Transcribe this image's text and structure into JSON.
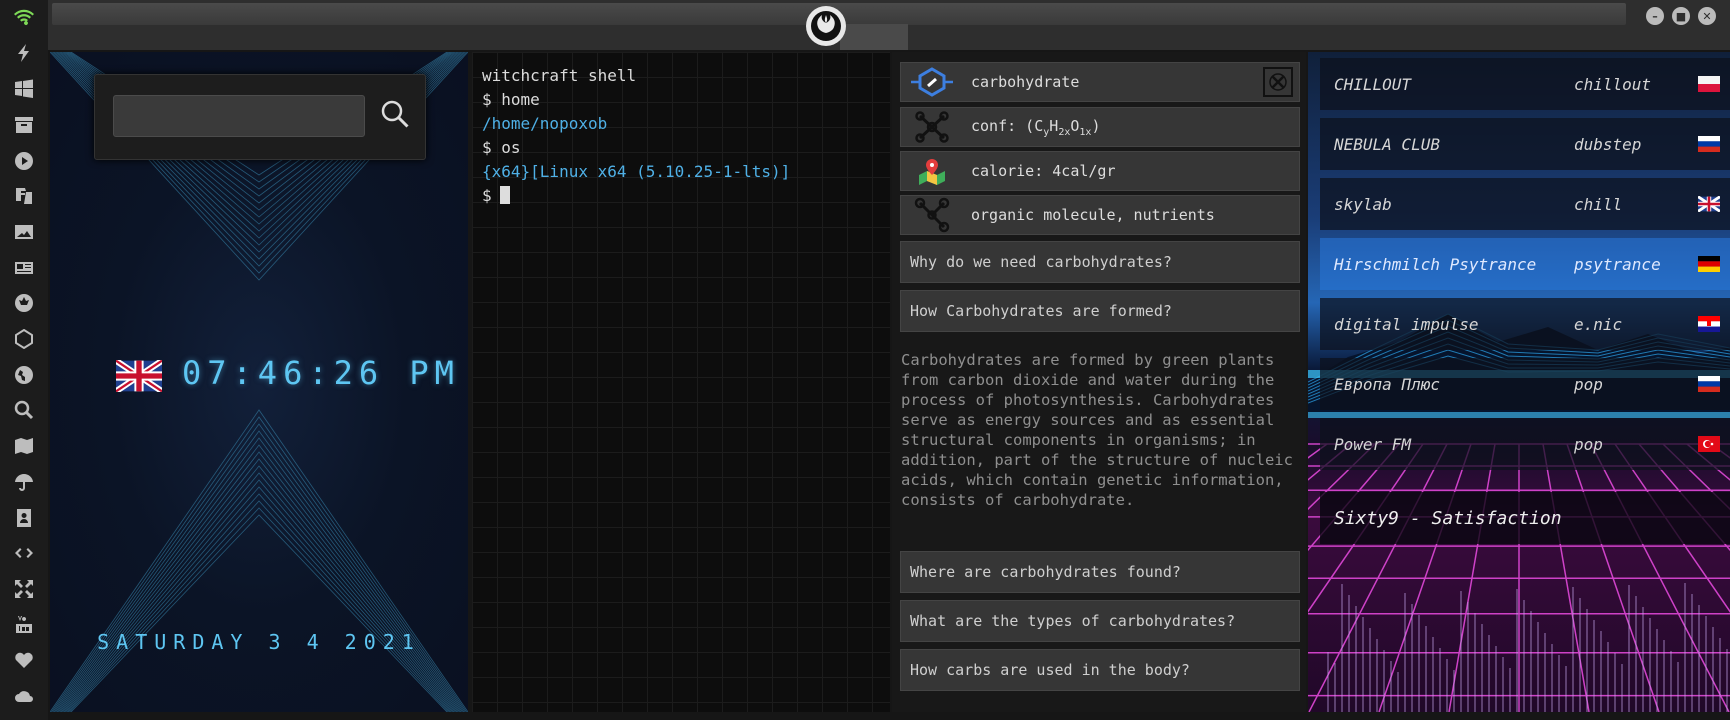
{
  "sidebar": {
    "icons": [
      "wifi-icon",
      "lightning-icon",
      "windows-icon",
      "archive-icon",
      "play-icon",
      "translate-icon",
      "image-icon",
      "newspaper-icon",
      "rebel-icon",
      "sketch-icon",
      "globe-icon",
      "search-icon",
      "map-icon",
      "umbrella-icon",
      "contact-icon",
      "code-icon",
      "expand-icon",
      "youtube-icon",
      "heart-icon",
      "cloud-icon"
    ]
  },
  "clock": {
    "search_placeholder": "",
    "time": "07:46:26 PM",
    "date": "SATURDAY 3 4 2021"
  },
  "terminal": {
    "lines": [
      "witchcraft shell",
      "$ home",
      "/home/nopoxob",
      "$ os",
      "{x64}[Linux x64 (5.10.25-1-lts)]",
      "$"
    ]
  },
  "info": {
    "title": "carbohydrate",
    "formula_prefix": "conf: (C",
    "formula_sub1": "y",
    "formula_h": "H",
    "formula_sub2": "2x",
    "formula_o": "O",
    "formula_sub3": "1x",
    "formula_suffix": ")",
    "calorie": "calorie: 4cal/gr",
    "category": "organic molecule, nutrients",
    "faq": [
      "Why do we need carbohydrates?",
      "How Carbohydrates are formed?",
      "Where are carbohydrates found?",
      "What are the types of carbohydrates?",
      "How carbs are used in the body?"
    ],
    "answer": "Carbohydrates are formed by green plants from carbon dioxide and water during the process of photosynthesis. Carbohydrates serve as energy sources and as essential structural components in organisms; in addition, part of the structure of nucleic acids, which contain genetic information, consists of carbohydrate."
  },
  "radio": {
    "stations": [
      {
        "name": "CHILLOUT",
        "genre": "chillout",
        "flag": "flag-pl"
      },
      {
        "name": "NEBULA CLUB",
        "genre": "dubstep",
        "flag": "flag-ru"
      },
      {
        "name": "skylab",
        "genre": "chill",
        "flag": "flag-uk"
      },
      {
        "name": "Hirschmilch Psytrance",
        "genre": "psytrance",
        "flag": "flag-de"
      },
      {
        "name": "digital impulse",
        "genre": "e.nic",
        "flag": "flag-hr"
      },
      {
        "name": "Европа Плюс",
        "genre": "pop",
        "flag": "flag-ru"
      },
      {
        "name": "Power FM",
        "genre": "pop",
        "flag": "flag-tr"
      }
    ],
    "now_playing": "Sixty9 - Satisfaction"
  }
}
